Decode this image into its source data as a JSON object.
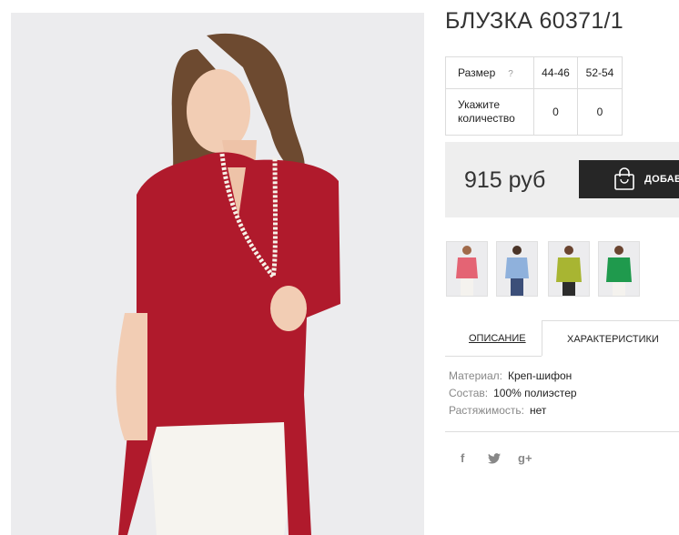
{
  "product": {
    "title": "БЛУЗКА 60371/1"
  },
  "size_table": {
    "size_header": "Размер",
    "help_icon": "?",
    "sizes": [
      "44-46",
      "52-54"
    ],
    "qty_label_line1": "Укажите",
    "qty_label_line2": "количество",
    "quantities": [
      "0",
      "0"
    ]
  },
  "purchase": {
    "price": "915 руб",
    "add_button": "ДОБАВ",
    "button_icon": "shopping-bag-icon"
  },
  "thumbnails": [
    {
      "color": "#e46474"
    },
    {
      "color": "#8fb1dc"
    },
    {
      "color": "#a8b532"
    },
    {
      "color": "#1f9a4d"
    }
  ],
  "tabs": {
    "description": "ОПИСАНИЕ",
    "characteristics": "ХАРАКТЕРИСТИКИ"
  },
  "specs": [
    {
      "label": "Материал:",
      "value": "Креп-шифон"
    },
    {
      "label": "Состав:",
      "value": "100% полиэстер"
    },
    {
      "label": "Растяжимость:",
      "value": "нет"
    }
  ],
  "social": {
    "facebook": "f",
    "twitter": "twitter-icon",
    "google": "g+"
  },
  "colors": {
    "blouse_red": "#b01a2c",
    "dark_button": "#262626",
    "panel_bg": "#eeeeee"
  }
}
